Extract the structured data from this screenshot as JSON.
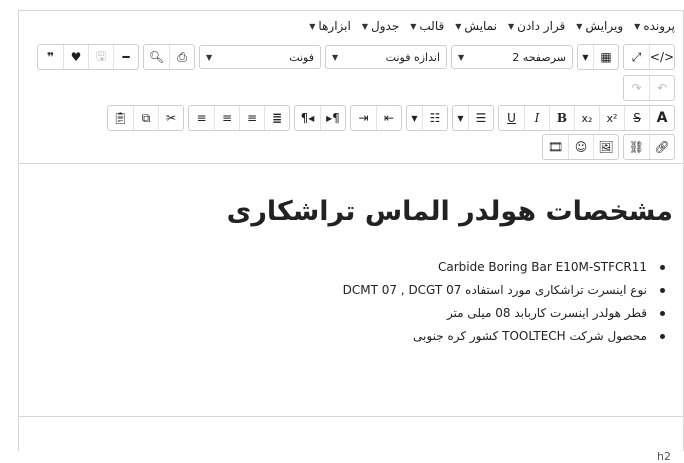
{
  "menubar": {
    "items": [
      {
        "label": "پرونده"
      },
      {
        "label": "ویرایش"
      },
      {
        "label": "قرار دادن"
      },
      {
        "label": "نمایش"
      },
      {
        "label": "قالب"
      },
      {
        "label": "جدول"
      },
      {
        "label": "ابزارها"
      }
    ]
  },
  "toolbar": {
    "format_select": "سرصفحه 2",
    "font_size_select": "اندازه فونت",
    "font_select": "فونت"
  },
  "content": {
    "heading": "مشخصات هولدر الماس تراشکاری",
    "list": [
      "Carbide Boring Bar E10M-STFCR11",
      "نوع اینسرت تراشکاری مورد استفاده DCMT 07 , DCGT 07",
      "قطر هولدر اینسرت کاربابد 08 میلی متر",
      "محصول شرکت TOOLTECH کشور کره جنوبی"
    ]
  },
  "statusbar": {
    "path": "h2"
  }
}
